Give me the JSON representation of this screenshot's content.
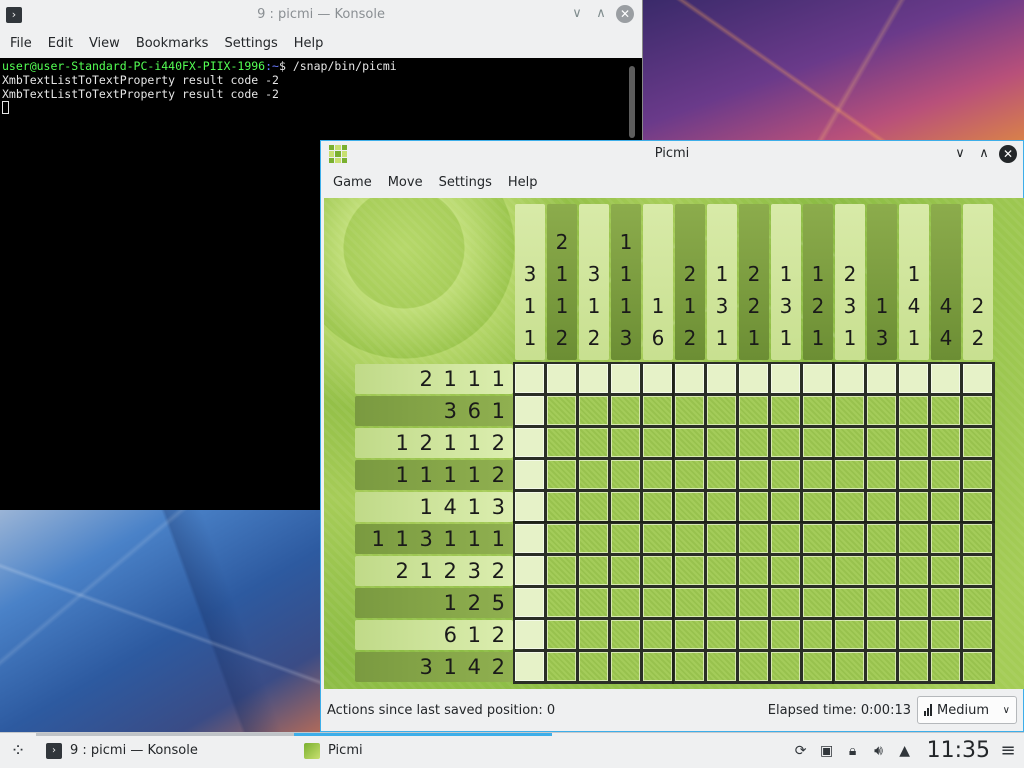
{
  "konsole": {
    "title": "9 : picmi — Konsole",
    "menu": [
      "File",
      "Edit",
      "View",
      "Bookmarks",
      "Settings",
      "Help"
    ],
    "prompt_user": "user@user-Standard-PC-i440FX-PIIX-1996",
    "prompt_path": ":~",
    "prompt_symbol": "$ ",
    "command": "/snap/bin/picmi",
    "output_lines": [
      "XmbTextListToTextProperty result code -2",
      "XmbTextListToTextProperty result code -2"
    ]
  },
  "picmi": {
    "title": "Picmi",
    "menu": [
      "Game",
      "Move",
      "Settings",
      "Help"
    ],
    "col_clues": [
      [
        "3",
        "1",
        "1"
      ],
      [
        "2",
        "1",
        "1",
        "2"
      ],
      [
        "3",
        "1",
        "2"
      ],
      [
        "1",
        "1",
        "1",
        "3"
      ],
      [
        "1",
        "6"
      ],
      [
        "2",
        "1",
        "2"
      ],
      [
        "1",
        "3",
        "1"
      ],
      [
        "2",
        "2",
        "1"
      ],
      [
        "1",
        "3",
        "1"
      ],
      [
        "1",
        "2",
        "1"
      ],
      [
        "2",
        "3",
        "1"
      ],
      [
        "1",
        "3"
      ],
      [
        "1",
        "4",
        "1"
      ],
      [
        "4",
        "4"
      ],
      [
        "2",
        "2"
      ]
    ],
    "row_clues": [
      "2 1 1 1",
      "3 6 1",
      "1 2 1 1 2",
      "1 1 1 1 2",
      "1 4 1 3",
      "1 1 3 1 1 1",
      "2 1 2 3 2",
      "1 2 5",
      "6 1 2",
      "3 1 4 2"
    ],
    "grid_cols": 15,
    "grid_rows": 10,
    "status_actions": "Actions since last saved position: 0",
    "status_elapsed": "Elapsed time: 0:00:13",
    "difficulty": "Medium"
  },
  "taskbar": {
    "tasks": [
      {
        "label": "9 : picmi — Konsole",
        "active": false
      },
      {
        "label": "Picmi",
        "active": true
      }
    ],
    "clock": "11:35",
    "tray_icons": [
      "updates-icon",
      "network-icon",
      "lock-icon",
      "volume-icon",
      "tray-expand-icon",
      "hamburger-menu-icon"
    ]
  },
  "colors": {
    "accent": "#3daee9",
    "board_green": "#a4cc5a",
    "terminal_bg": "#000000",
    "prompt_green": "#54ff54"
  }
}
